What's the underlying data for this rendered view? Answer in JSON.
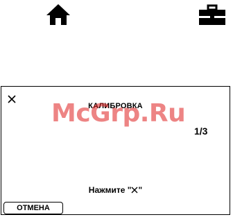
{
  "top_icons": {
    "home": "home-icon",
    "settings": "toolbox-icon"
  },
  "screen": {
    "title": "КАЛИБРОВКА",
    "watermark": "McGrp.Ru",
    "page_counter": "1/3",
    "instruction_prefix": "Нажмите \"",
    "instruction_suffix": "\"",
    "instruction_icon": "close-x-icon",
    "cancel_label": "ОТМЕНА",
    "close_icon": "close-x-icon"
  },
  "colors": {
    "watermark": "#e02020",
    "foreground": "#000000",
    "background": "#ffffff"
  }
}
